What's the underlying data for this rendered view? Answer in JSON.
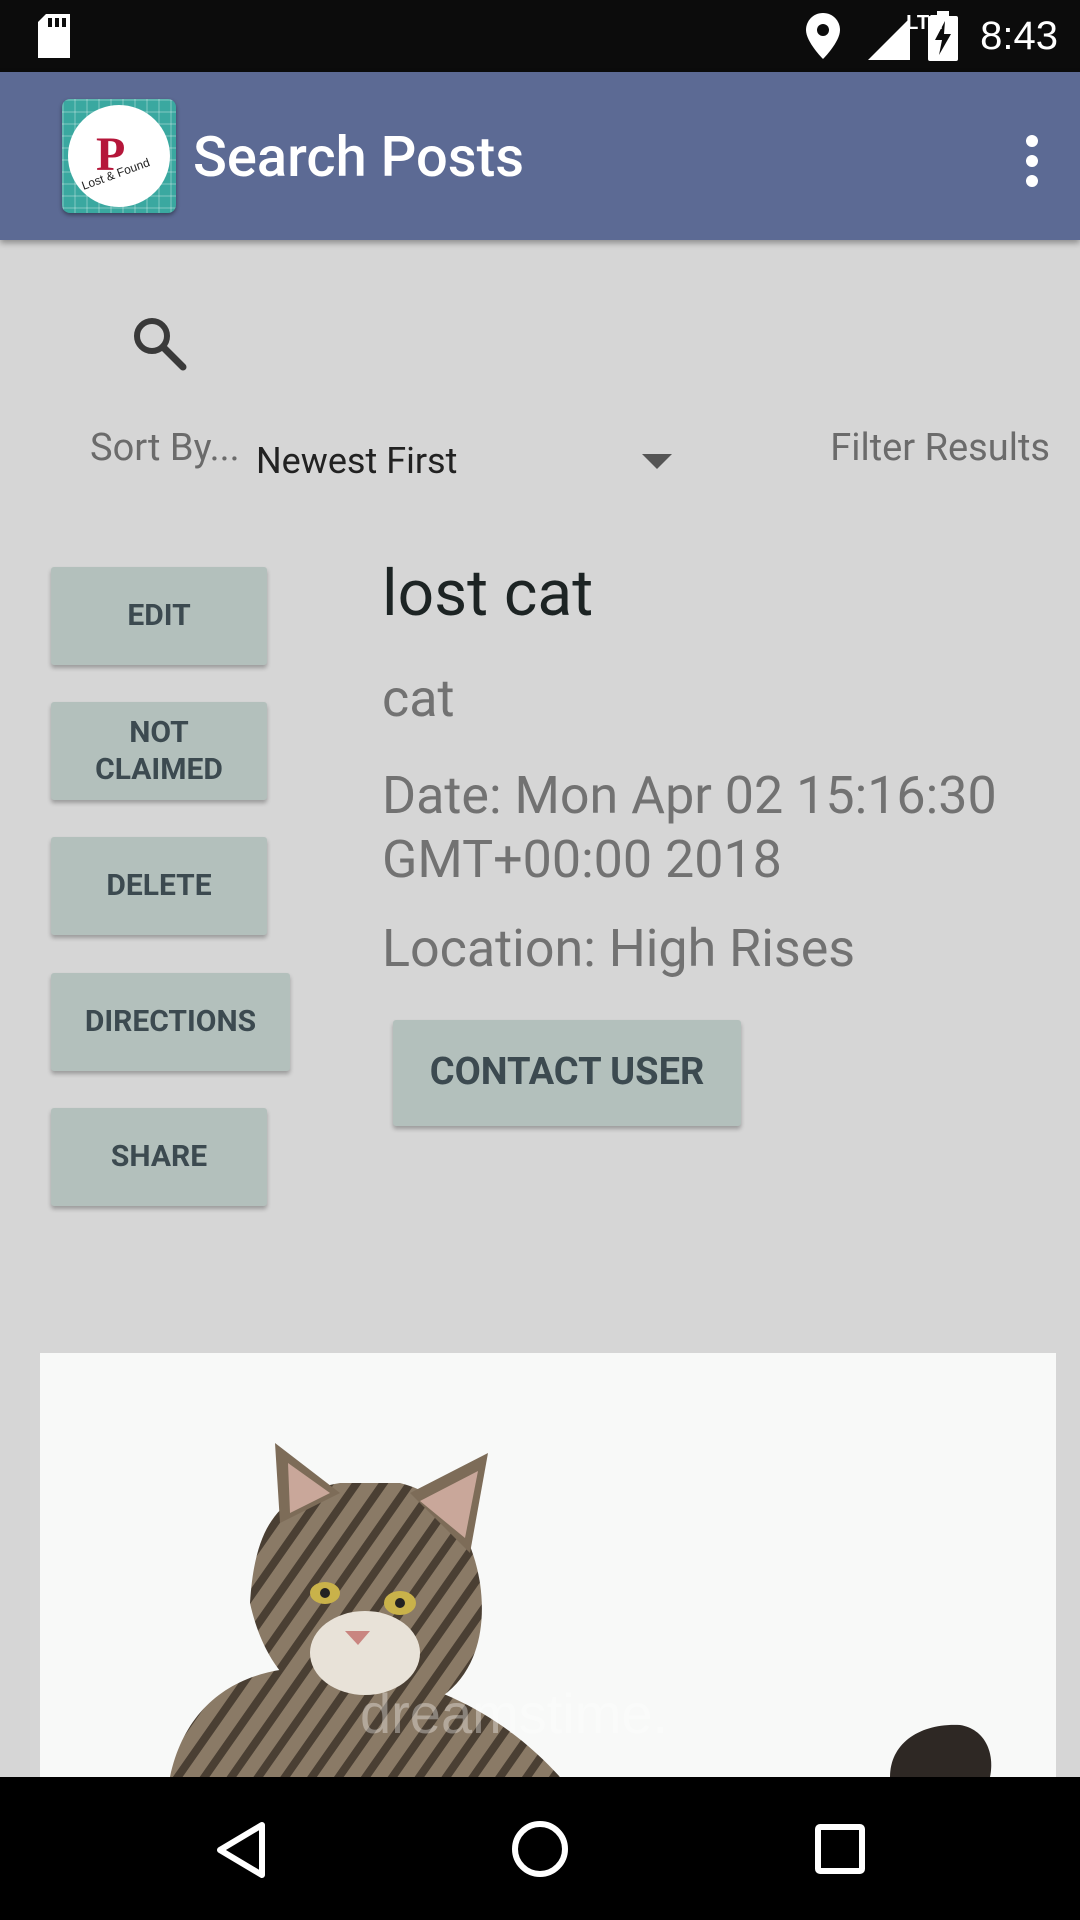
{
  "status_bar": {
    "time": "8:43",
    "network": "LTE",
    "icons": [
      "sd-card-icon",
      "location-icon",
      "signal-icon",
      "battery-charging-icon"
    ]
  },
  "app_bar": {
    "title": "Search Posts",
    "logo_letter": "P",
    "logo_caption": "Lost & Found",
    "menu_icon": "overflow-menu-icon",
    "color": "#5c6a94"
  },
  "search": {
    "icon": "search-icon"
  },
  "sort": {
    "label": "Sort By...",
    "selected": "Newest First"
  },
  "filter": {
    "label": "Filter Results"
  },
  "actions": {
    "edit": "EDIT",
    "not_claimed_line1": "NOT",
    "not_claimed_line2": "CLAIMED",
    "delete": "DELETE",
    "directions": "DIRECTIONS",
    "share": "SHARE"
  },
  "post": {
    "title": "lost cat",
    "category": "cat",
    "date": "Date: Mon Apr 02 15:16:30 GMT+00:00 2018",
    "location": "Location: High Rises",
    "contact_label": "CONTACT USER",
    "image_watermark": "dreamstime."
  },
  "nav_bar": {
    "icons": [
      "back-icon",
      "home-icon",
      "recents-icon"
    ]
  }
}
